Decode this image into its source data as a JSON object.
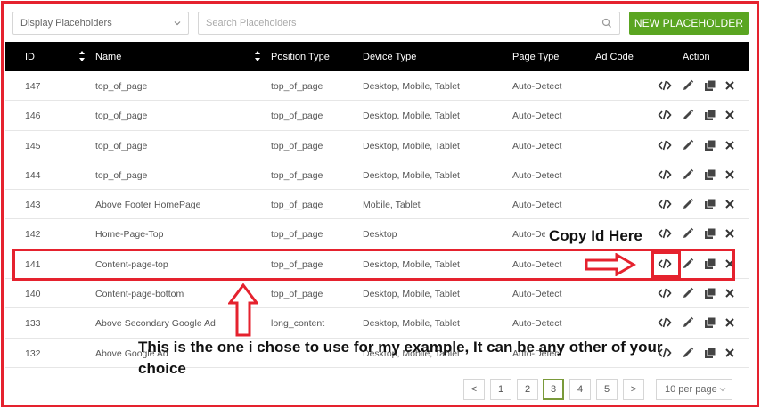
{
  "toolbar": {
    "display_select": "Display Placeholders",
    "search_placeholder": "Search Placeholders",
    "new_button": "NEW PLACEHOLDER"
  },
  "table": {
    "headers": [
      "ID",
      "Name",
      "Position Type",
      "Device Type",
      "Page Type",
      "Ad Code",
      "Action"
    ],
    "rows": [
      [
        "147",
        "top_of_page",
        "top_of_page",
        "Desktop, Mobile, Tablet",
        "Auto-Detect"
      ],
      [
        "146",
        "top_of_page",
        "top_of_page",
        "Desktop, Mobile, Tablet",
        "Auto-Detect"
      ],
      [
        "145",
        "top_of_page",
        "top_of_page",
        "Desktop, Mobile, Tablet",
        "Auto-Detect"
      ],
      [
        "144",
        "top_of_page",
        "top_of_page",
        "Desktop, Mobile, Tablet",
        "Auto-Detect"
      ],
      [
        "143",
        "Above Footer HomePage",
        "top_of_page",
        "Mobile, Tablet",
        "Auto-Detect"
      ],
      [
        "142",
        "Home-Page-Top",
        "top_of_page",
        "Desktop",
        "Auto-Detect"
      ],
      [
        "141",
        "Content-page-top",
        "top_of_page",
        "Desktop, Mobile, Tablet",
        "Auto-Detect"
      ],
      [
        "140",
        "Content-page-bottom",
        "top_of_page",
        "Desktop, Mobile, Tablet",
        "Auto-Detect"
      ],
      [
        "133",
        "Above Secondary Google Ad",
        "long_content",
        "Desktop, Mobile, Tablet",
        "Auto-Detect"
      ],
      [
        "132",
        "Above Google Ad",
        "",
        "Desktop, Mobile, Tablet",
        "Auto-Detect"
      ]
    ]
  },
  "pagination": {
    "prev": "<",
    "pages": [
      "1",
      "2",
      "3",
      "4",
      "5"
    ],
    "current": "3",
    "next": ">",
    "per_page": "10 per page"
  },
  "annotations": {
    "copy_id": "Copy Id Here",
    "note": "This is the one i chose to use for my example, It can be any other of your choice"
  },
  "colors": {
    "accent_green": "#5aa521",
    "header_bg": "#000000",
    "annotation_red": "#e5222e"
  }
}
